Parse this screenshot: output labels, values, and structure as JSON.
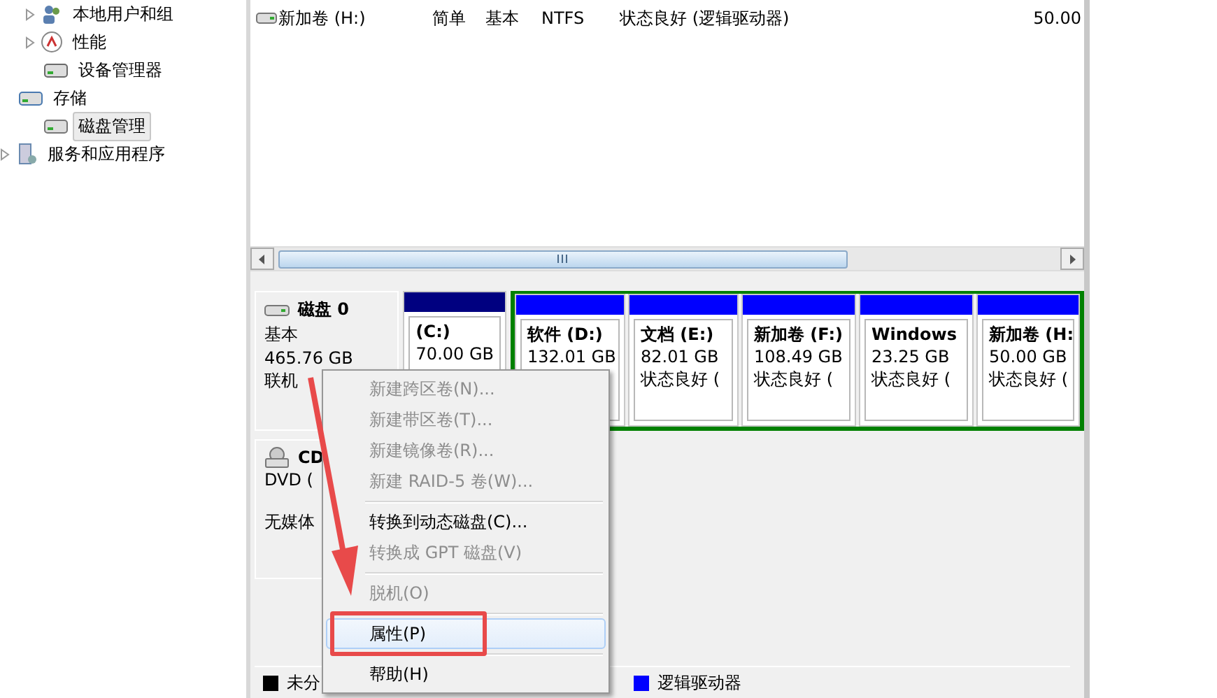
{
  "tree": [
    {
      "children": [
        {
          "label": "本地用户和组",
          "expander": true,
          "selected": false
        },
        {
          "label": "性能",
          "expander": true,
          "selected": false
        },
        {
          "label": "设备管理器",
          "expander": false,
          "selected": false
        }
      ]
    },
    {
      "label": "存储",
      "expander": false,
      "selected": false,
      "children": [
        {
          "label": "磁盘管理",
          "expander": false,
          "selected": true
        }
      ]
    },
    {
      "label": "服务和应用程序",
      "expander": true,
      "selected": false
    }
  ],
  "volume_list": {
    "rows": [
      {
        "name": "新加卷 (H:)",
        "layout": "简单",
        "type": "基本",
        "filesystem": "NTFS",
        "status": "状态良好 (逻辑驱动器)",
        "capacity": "50.00"
      }
    ]
  },
  "disks": [
    {
      "name": "磁盘 0",
      "lines": [
        "基本",
        "465.76 GB",
        "联机"
      ],
      "kind": "hdd",
      "partitions": [
        {
          "kind": "primary",
          "name": "(C:)",
          "size": "70.00 GB"
        },
        {
          "kind": "logical",
          "name": "软件 (D:)",
          "size": "132.01 GB"
        },
        {
          "kind": "logical",
          "name": "文档 (E:)",
          "size": "82.01 GB",
          "status": "状态良好 ("
        },
        {
          "kind": "logical",
          "name": "新加卷 (F:)",
          "size": "108.49 GB",
          "status": "状态良好 ("
        },
        {
          "kind": "logical",
          "name": "Windows",
          "size": "23.25 GB",
          "status": "状态良好 ("
        },
        {
          "kind": "logical",
          "name": "新加卷 (H:",
          "size": "50.00 GB",
          "status": "状态良好 ("
        }
      ]
    },
    {
      "name": "CD",
      "lines": [
        "DVD (",
        "无媒体"
      ],
      "kind": "cd"
    }
  ],
  "legend": [
    {
      "label": "未分",
      "color": "#000000"
    },
    {
      "label": "逻辑驱动器",
      "color": "#0000ff"
    }
  ],
  "context_menu": [
    {
      "kind": "item",
      "label": "新建跨区卷(N)...",
      "disabled": true,
      "selected": false
    },
    {
      "kind": "item",
      "label": "新建带区卷(T)...",
      "disabled": true,
      "selected": false
    },
    {
      "kind": "item",
      "label": "新建镜像卷(R)...",
      "disabled": true,
      "selected": false
    },
    {
      "kind": "item",
      "label": "新建 RAID-5 卷(W)...",
      "disabled": true,
      "selected": false
    },
    {
      "kind": "separator"
    },
    {
      "kind": "item",
      "label": "转换到动态磁盘(C)...",
      "disabled": false,
      "selected": false
    },
    {
      "kind": "item",
      "label": "转换成 GPT 磁盘(V)",
      "disabled": true,
      "selected": false
    },
    {
      "kind": "separator"
    },
    {
      "kind": "item",
      "label": "脱机(O)",
      "disabled": true,
      "selected": false
    },
    {
      "kind": "separator"
    },
    {
      "kind": "item",
      "label": "属性(P)",
      "disabled": false,
      "selected": true
    },
    {
      "kind": "separator"
    },
    {
      "kind": "item",
      "label": "帮助(H)",
      "disabled": false,
      "selected": false
    }
  ]
}
